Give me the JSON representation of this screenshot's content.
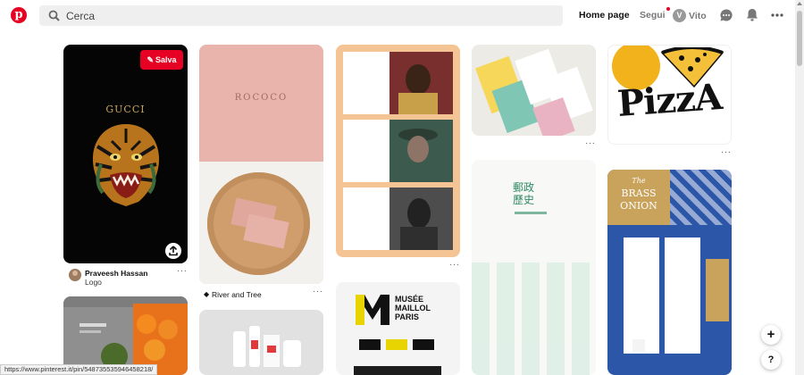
{
  "header": {
    "logo_letter": "p",
    "search_placeholder": "Cerca",
    "nav_home": "Home page",
    "nav_follow": "Segui",
    "user_initial": "V",
    "user_name": "Vito"
  },
  "pins": {
    "gucci": {
      "brand": "GUCCI",
      "save_label": "Salva",
      "author": "Praveesh Hassan",
      "board": "Logo"
    },
    "rococo": {
      "brand": "ROCOCO",
      "caption": "River and Tree"
    },
    "museum": {
      "line1": "MUSÉE",
      "line2": "MAILLOL",
      "line3": "PARIS"
    },
    "pizza": {
      "word": "PizzA"
    },
    "brass": {
      "line1": "The",
      "line2": "BRASS",
      "line3": "ONION"
    },
    "chinese": {
      "title": "郵政歷史"
    }
  },
  "status_url": "https://www.pinterest.it/pin/548735535946458218/",
  "fab": {
    "add": "+",
    "help": "?"
  },
  "colors": {
    "brand_red": "#e60023",
    "search_bg": "#efefef",
    "rococo_pink": "#e8b4ac",
    "brass_blue": "#2c56a8"
  }
}
